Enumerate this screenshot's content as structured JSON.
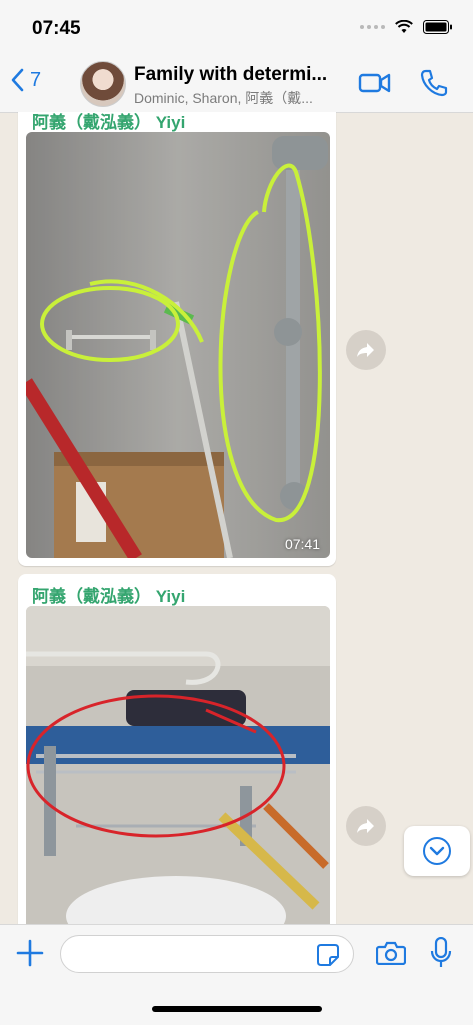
{
  "status": {
    "time": "07:45"
  },
  "header": {
    "back_count": "7",
    "title": "Family with determi...",
    "subtitle": "Dominic, Sharon, 阿義（戴..."
  },
  "messages": [
    {
      "sender": "阿義（戴泓義） Yiyi",
      "time": "07:41",
      "image": "photo-wall-rail-and-pole"
    },
    {
      "sender": "阿義（戴泓義） Yiyi",
      "image": "photo-shelf-rack"
    }
  ],
  "colors": {
    "accent": "#1f7ae0",
    "sender": "#34a56f",
    "chat_background": "#efeae2"
  },
  "icons": [
    "back-chevron-icon",
    "video-call-icon",
    "phone-icon",
    "forward-icon",
    "scroll-down-icon",
    "plus-icon",
    "sticker-icon",
    "camera-icon",
    "microphone-icon",
    "wifi-icon",
    "battery-icon"
  ]
}
